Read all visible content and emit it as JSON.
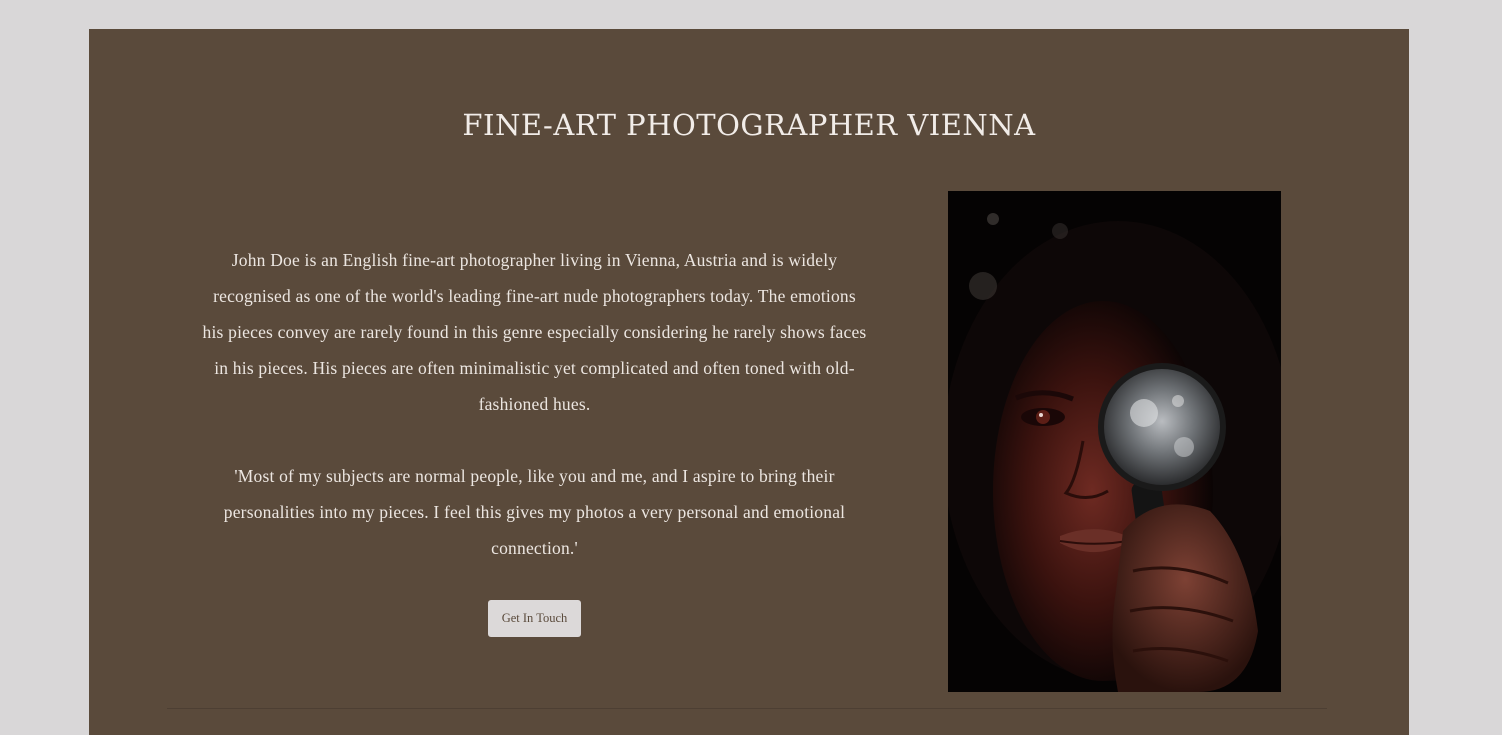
{
  "page": {
    "title": "FINE-ART PHOTOGRAPHER VIENNA",
    "paragraphs": [
      "John Doe is an English fine-art photographer living in Vienna, Austria and is widely recognised as one of the world's leading fine-art nude photographers today. The emotions his pieces convey are rarely found in this genre especially considering he rarely shows faces in his pieces. His pieces are often minimalistic yet complicated and often toned with old-fashioned hues.",
      "'Most of my subjects are normal people, like you and me, and I aspire to bring their personalities into my pieces. I feel this gives my photos a very personal and emotional connection.'"
    ],
    "cta_label": "Get In Touch",
    "image_alt": "Portrait of a woman holding a magnifying glass over her eye"
  },
  "colors": {
    "page_background": "#d9d7d8",
    "panel_background": "#5a4a3b",
    "text": "#ece6e1",
    "button_background": "#dcd9d9"
  }
}
